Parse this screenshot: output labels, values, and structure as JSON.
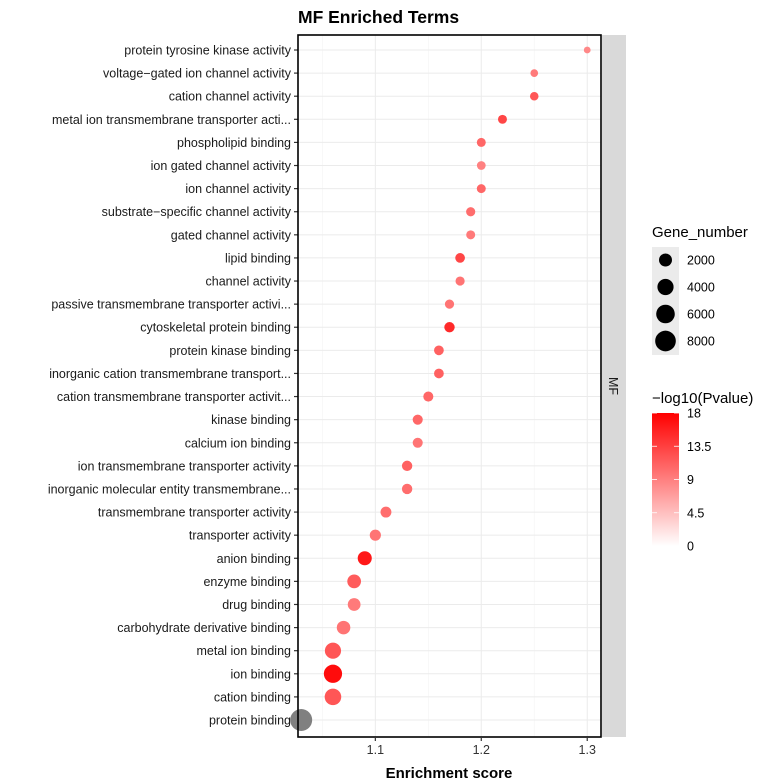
{
  "chart_data": {
    "type": "scatter",
    "title": "MF Enriched Terms",
    "xlabel": "Enrichment score",
    "ylabel": "",
    "xlim": [
      1.027,
      1.313
    ],
    "xticks": [
      1.1,
      1.2,
      1.3
    ],
    "xtick_labels": [
      "1.1",
      "1.2",
      "1.3"
    ],
    "grid": true,
    "facet_label": "MF",
    "terms": [
      {
        "term": "protein tyrosine kinase activity",
        "score": 1.3,
        "gene_number": 150,
        "neglog10p": 4.5
      },
      {
        "term": "voltage−gated ion channel activity",
        "score": 1.25,
        "gene_number": 250,
        "neglog10p": 5.5
      },
      {
        "term": "cation channel activity",
        "score": 1.25,
        "gene_number": 400,
        "neglog10p": 8.5
      },
      {
        "term": "metal ion transmembrane transporter acti...",
        "score": 1.22,
        "gene_number": 500,
        "neglog10p": 10
      },
      {
        "term": "phospholipid binding",
        "score": 1.2,
        "gene_number": 500,
        "neglog10p": 7
      },
      {
        "term": "ion gated channel activity",
        "score": 1.2,
        "gene_number": 450,
        "neglog10p": 5
      },
      {
        "term": "ion channel activity",
        "score": 1.2,
        "gene_number": 500,
        "neglog10p": 7
      },
      {
        "term": "substrate−specific channel activity",
        "score": 1.19,
        "gene_number": 550,
        "neglog10p": 6.5
      },
      {
        "term": "gated channel activity",
        "score": 1.19,
        "gene_number": 500,
        "neglog10p": 5.5
      },
      {
        "term": "lipid binding",
        "score": 1.18,
        "gene_number": 700,
        "neglog10p": 10
      },
      {
        "term": "channel activity",
        "score": 1.18,
        "gene_number": 550,
        "neglog10p": 6
      },
      {
        "term": "passive transmembrane transporter activi...",
        "score": 1.17,
        "gene_number": 550,
        "neglog10p": 6
      },
      {
        "term": "cytoskeletal protein binding",
        "score": 1.17,
        "gene_number": 900,
        "neglog10p": 13
      },
      {
        "term": "protein kinase binding",
        "score": 1.16,
        "gene_number": 700,
        "neglog10p": 7.5
      },
      {
        "term": "inorganic cation transmembrane transport...",
        "score": 1.16,
        "gene_number": 700,
        "neglog10p": 7.5
      },
      {
        "term": "cation transmembrane transporter activit...",
        "score": 1.15,
        "gene_number": 800,
        "neglog10p": 7
      },
      {
        "term": "kinase binding",
        "score": 1.14,
        "gene_number": 800,
        "neglog10p": 7
      },
      {
        "term": "calcium ion binding",
        "score": 1.14,
        "gene_number": 800,
        "neglog10p": 6
      },
      {
        "term": "ion transmembrane transporter activity",
        "score": 1.13,
        "gene_number": 900,
        "neglog10p": 7.5
      },
      {
        "term": "inorganic molecular entity transmembrane...",
        "score": 1.13,
        "gene_number": 900,
        "neglog10p": 6.5
      },
      {
        "term": "transmembrane transporter activity",
        "score": 1.11,
        "gene_number": 1100,
        "neglog10p": 6.5
      },
      {
        "term": "transporter activity",
        "score": 1.1,
        "gene_number": 1200,
        "neglog10p": 6
      },
      {
        "term": "anion binding",
        "score": 1.09,
        "gene_number": 2600,
        "neglog10p": 15
      },
      {
        "term": "enzyme binding",
        "score": 1.08,
        "gene_number": 2400,
        "neglog10p": 8
      },
      {
        "term": "drug binding",
        "score": 1.08,
        "gene_number": 1900,
        "neglog10p": 5.5
      },
      {
        "term": "carbohydrate derivative binding",
        "score": 1.07,
        "gene_number": 2300,
        "neglog10p": 6
      },
      {
        "term": "metal ion binding",
        "score": 1.06,
        "gene_number": 4000,
        "neglog10p": 8.5
      },
      {
        "term": "ion binding",
        "score": 1.06,
        "gene_number": 5700,
        "neglog10p": 16.5
      },
      {
        "term": "cation binding",
        "score": 1.06,
        "gene_number": 4300,
        "neglog10p": 8.5
      },
      {
        "term": "protein binding",
        "score": 1.03,
        "gene_number": 9500,
        "neglog10p": null
      }
    ],
    "na_color": "#808080",
    "size_legend": {
      "title": "Gene_number",
      "breaks": [
        2000,
        4000,
        6000,
        8000
      ],
      "labels": [
        "2000",
        "4000",
        "6000",
        "8000"
      ],
      "range": [
        100,
        9500
      ]
    },
    "color_legend": {
      "title": "−log10(Pvalue)",
      "low_color": "#ffffff",
      "high_color": "#ff0000",
      "limits": [
        0,
        18
      ],
      "breaks": [
        0,
        4.5,
        9,
        13.5,
        18
      ],
      "labels": [
        "0",
        "4.5",
        "9",
        "13.5",
        "18"
      ]
    }
  }
}
